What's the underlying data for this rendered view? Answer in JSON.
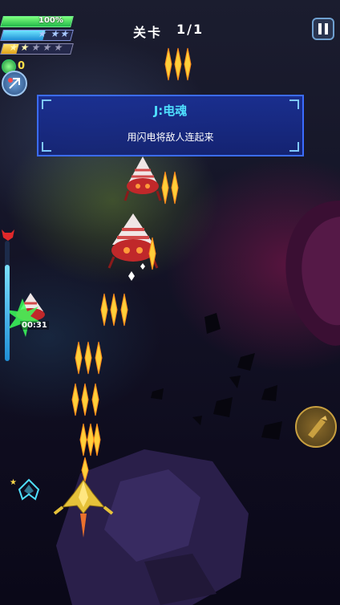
{
  "hud": {
    "hp_percent_label": "100%",
    "hp_fraction": 1.0,
    "shield_fraction": 0.6,
    "stars": {
      "filled": 2,
      "total": 5
    },
    "coin_count": "0",
    "level_label": "关卡",
    "level_value": "1/1",
    "timer": "00:31",
    "stage_progress_fraction": 0.8
  },
  "banner": {
    "title": "J:电魂",
    "description": "用闪电将敌人连起来"
  },
  "icons": {
    "pause": "pause-icon",
    "skill": "lightning-skill-icon",
    "weapon": "missile-weapon-icon",
    "boss_marker": "red-demon-icon",
    "coin": "green-coin-icon"
  },
  "colors": {
    "hp": "#3fdc5a",
    "shield": "#3bb8f0",
    "stars": "#f0c02a",
    "banner_bg": "#1a2f95",
    "banner_title": "#4fe0ff",
    "bullet": "#ffcf3a"
  }
}
